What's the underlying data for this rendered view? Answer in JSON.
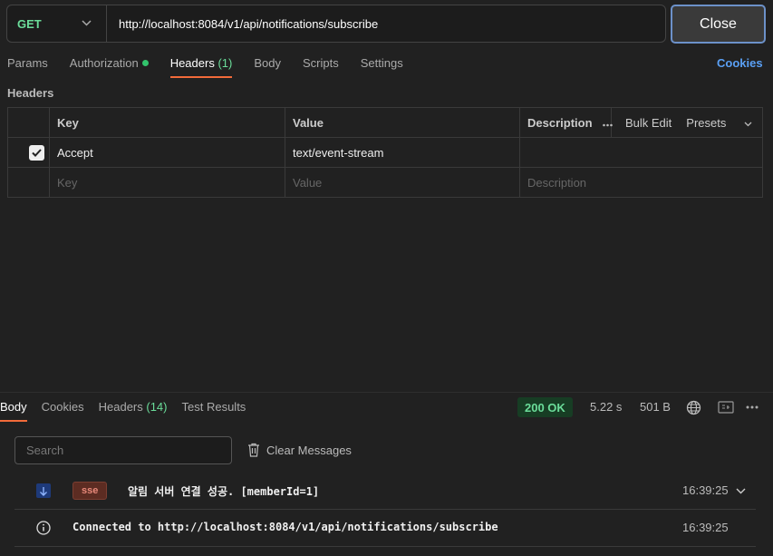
{
  "request": {
    "method": "GET",
    "url": "http://localhost:8084/v1/api/notifications/subscribe",
    "close_label": "Close"
  },
  "request_tabs": [
    {
      "label": "Params"
    },
    {
      "label": "Authorization"
    },
    {
      "label": "Headers",
      "count": "(1)"
    },
    {
      "label": "Body"
    },
    {
      "label": "Scripts"
    },
    {
      "label": "Settings"
    }
  ],
  "cookies_label": "Cookies",
  "headers_section": {
    "title": "Headers",
    "columns": {
      "key": "Key",
      "value": "Value",
      "description": "Description"
    },
    "bulk_edit": "Bulk Edit",
    "presets": "Presets",
    "rows": [
      {
        "checked": true,
        "key": "Accept",
        "value": "text/event-stream",
        "description": ""
      }
    ],
    "placeholder": {
      "key": "Key",
      "value": "Value",
      "description": "Description"
    }
  },
  "response": {
    "tabs": [
      {
        "label": "Body"
      },
      {
        "label": "Cookies"
      },
      {
        "label": "Headers",
        "count": "(14)"
      },
      {
        "label": "Test Results"
      }
    ],
    "status": "200 OK",
    "time": "5.22 s",
    "size": "501 B",
    "search_placeholder": "Search",
    "clear_label": "Clear Messages",
    "messages": [
      {
        "icon": "arrow-down-icon",
        "badge": "sse",
        "text": "알림 서버 연결 성공. [memberId=1]",
        "time": "16:39:25"
      },
      {
        "icon": "info-icon",
        "text": "Connected to http://localhost:8084/v1/api/notifications/subscribe",
        "time": "16:39:25"
      }
    ]
  },
  "colors": {
    "accent_tab": "#f26b3a",
    "method_get": "#6bdd9a",
    "status_ok": "#6bdd9a",
    "link": "#5aa0f5"
  }
}
